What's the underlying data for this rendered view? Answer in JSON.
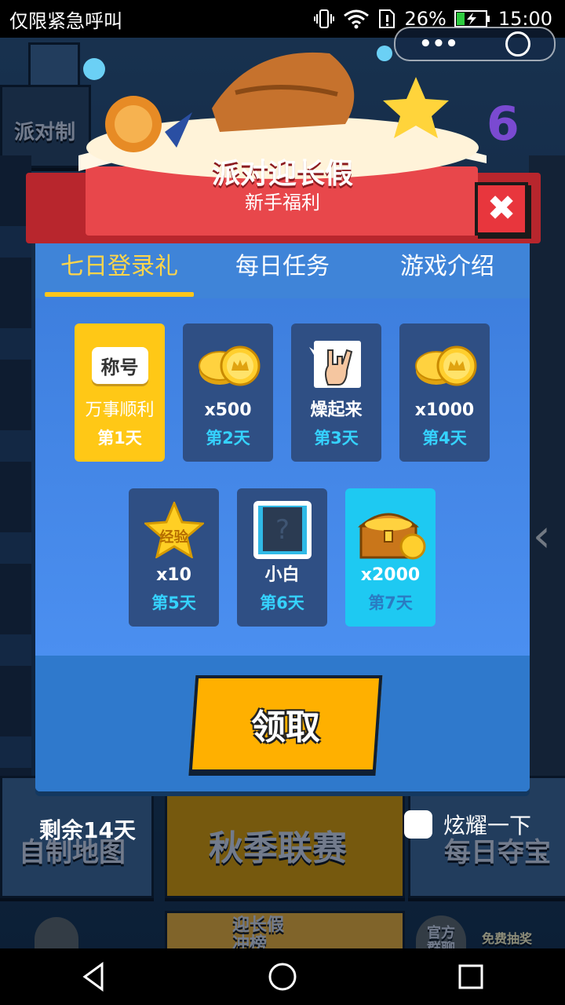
{
  "status_bar": {
    "carrier_text": "仅限紧急呼叫",
    "battery": "26%",
    "time": "15:00"
  },
  "background": {
    "party_label": "派对制",
    "bottom_left": "自制地图",
    "bottom_center": "秋季联赛",
    "bottom_right": "每日夺宝",
    "promo_line1": "迎长假",
    "promo_line2": "冲榜",
    "promo_right1": "官方",
    "promo_right2": "群聊",
    "lottery": "免费抽奖"
  },
  "header": {
    "title": "派对迎长假",
    "subtitle": "新手福利"
  },
  "tabs": [
    {
      "label": "七日登录礼",
      "active": true
    },
    {
      "label": "每日任务",
      "active": false
    },
    {
      "label": "游戏介绍",
      "active": false
    }
  ],
  "rewards": [
    {
      "icon": "title-badge-icon",
      "badge_text": "称号",
      "name": "万事顺利",
      "day": "第1天",
      "state": "today"
    },
    {
      "icon": "coins-icon",
      "name": "x500",
      "day": "第2天",
      "state": "normal"
    },
    {
      "icon": "rock-hand-icon",
      "name": "燥起来",
      "day": "第3天",
      "state": "normal"
    },
    {
      "icon": "coins-icon",
      "name": "x1000",
      "day": "第4天",
      "state": "normal"
    },
    {
      "icon": "exp-star-icon",
      "badge_text": "经验",
      "name": "x10",
      "day": "第5天",
      "state": "normal"
    },
    {
      "icon": "avatar-frame-icon",
      "name": "小白",
      "day": "第6天",
      "state": "normal"
    },
    {
      "icon": "treasure-chest-icon",
      "name": "x2000",
      "day": "第7天",
      "state": "big"
    }
  ],
  "claim_label": "领取",
  "remaining_label": "剩余14天",
  "share_label": "炫耀一下",
  "colors": {
    "accent_yellow": "#ffc816",
    "modal_blue": "#3a7fd2",
    "banner_red": "#e8474b",
    "day_cyan": "#35d2ff"
  }
}
